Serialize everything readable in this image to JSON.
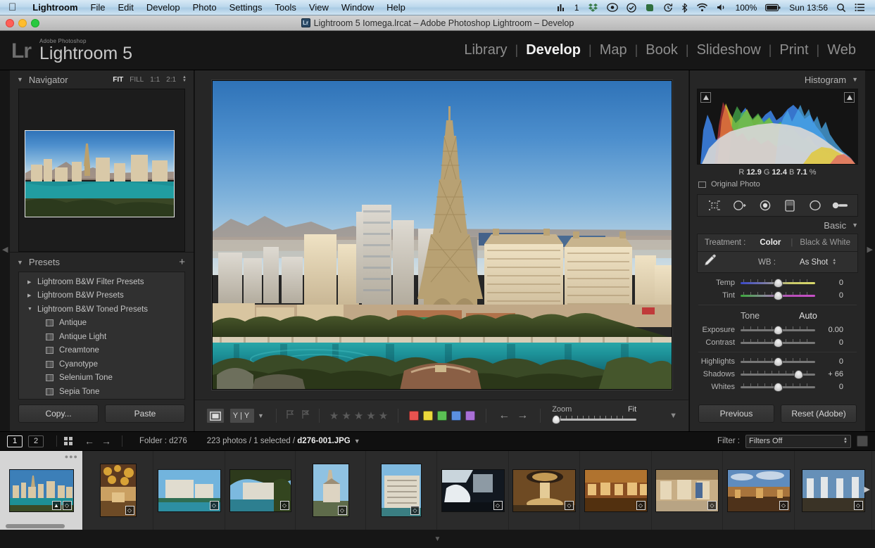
{
  "macmenu": {
    "apple_icon": "apple-logo",
    "items": [
      {
        "label": "Lightroom",
        "bold": true
      },
      {
        "label": "File",
        "bold": false
      },
      {
        "label": "Edit",
        "bold": false
      },
      {
        "label": "Develop",
        "bold": false
      },
      {
        "label": "Photo",
        "bold": false
      },
      {
        "label": "Settings",
        "bold": false
      },
      {
        "label": "Tools",
        "bold": false
      },
      {
        "label": "View",
        "bold": false
      },
      {
        "label": "Window",
        "bold": false
      },
      {
        "label": "Help",
        "bold": false
      }
    ],
    "status": {
      "istat_count": "1",
      "battery_percent": "100%",
      "clock": "Sun 13:56"
    }
  },
  "titlebar": {
    "title": "Lightroom 5 Iomega.lrcat – Adobe Photoshop Lightroom – Develop",
    "doc_icon_label": "Lr"
  },
  "header": {
    "logo_mark": "Lr",
    "logo_superscript": "Adobe Photoshop",
    "logo_name": "Lightroom 5",
    "modules": [
      {
        "label": "Library",
        "active": false
      },
      {
        "label": "Develop",
        "active": true
      },
      {
        "label": "Map",
        "active": false
      },
      {
        "label": "Book",
        "active": false
      },
      {
        "label": "Slideshow",
        "active": false
      },
      {
        "label": "Print",
        "active": false
      },
      {
        "label": "Web",
        "active": false
      }
    ]
  },
  "left_panel": {
    "navigator": {
      "title": "Navigator",
      "zoom_options": [
        {
          "label": "FIT",
          "active": true
        },
        {
          "label": "FILL",
          "active": false
        },
        {
          "label": "1:1",
          "active": false
        },
        {
          "label": "2:1",
          "active": false
        }
      ]
    },
    "presets": {
      "title": "Presets",
      "add_label": "+",
      "items": [
        {
          "label": "Lightroom B&W Filter Presets",
          "type": "group",
          "expanded": false
        },
        {
          "label": "Lightroom B&W Presets",
          "type": "group",
          "expanded": false
        },
        {
          "label": "Lightroom B&W Toned Presets",
          "type": "group",
          "expanded": true
        },
        {
          "label": "Antique",
          "type": "preset"
        },
        {
          "label": "Antique Light",
          "type": "preset"
        },
        {
          "label": "Creamtone",
          "type": "preset"
        },
        {
          "label": "Cyanotype",
          "type": "preset"
        },
        {
          "label": "Selenium Tone",
          "type": "preset"
        },
        {
          "label": "Sepia Tone",
          "type": "preset"
        }
      ]
    },
    "buttons": {
      "copy": "Copy...",
      "paste": "Paste"
    }
  },
  "right_panel": {
    "histogram": {
      "title": "Histogram",
      "readout": {
        "r_label": "R",
        "r_value": "12.9",
        "g_label": "G",
        "g_value": "12.4",
        "b_label": "B",
        "b_value": "7.1",
        "unit": "%"
      },
      "original_photo_label": "Original Photo"
    },
    "tools": [
      {
        "name": "crop-overlay-icon"
      },
      {
        "name": "spot-removal-icon"
      },
      {
        "name": "red-eye-correction-icon"
      },
      {
        "name": "graduated-filter-icon"
      },
      {
        "name": "radial-filter-icon"
      },
      {
        "name": "adjustment-brush-icon"
      }
    ],
    "basic": {
      "title": "Basic",
      "treatment_label": "Treatment :",
      "treatment_options": [
        {
          "label": "Color",
          "active": true
        },
        {
          "label": "Black & White",
          "active": false
        }
      ],
      "wb_label": "WB :",
      "wb_value": "As Shot",
      "wb_sliders": [
        {
          "name": "Temp",
          "value": "0",
          "pos": 50,
          "track": "temp"
        },
        {
          "name": "Tint",
          "value": "0",
          "pos": 50,
          "track": "tint"
        }
      ],
      "tone_label": "Tone",
      "auto_label": "Auto",
      "tone_sliders": [
        {
          "name": "Exposure",
          "value": "0.00",
          "pos": 50,
          "track": "plain"
        },
        {
          "name": "Contrast",
          "value": "0",
          "pos": 50,
          "track": "plain"
        }
      ],
      "tone_sliders2": [
        {
          "name": "Highlights",
          "value": "0",
          "pos": 50,
          "track": "plain"
        },
        {
          "name": "Shadows",
          "value": "+ 66",
          "pos": 78,
          "track": "plain"
        },
        {
          "name": "Whites",
          "value": "0",
          "pos": 50,
          "track": "plain"
        }
      ]
    },
    "buttons": {
      "previous": "Previous",
      "reset": "Reset (Adobe)"
    }
  },
  "toolbar": {
    "view_icon": "loupe-view-icon",
    "compare_label": "Y|Y",
    "stars": 5,
    "color_labels": [
      "#e8534f",
      "#ecd93b",
      "#5bc054",
      "#5b8fe0",
      "#a96fd6"
    ],
    "zoom_label": "Zoom",
    "zoom_value": "Fit"
  },
  "filmstrip_bar": {
    "page_buttons": [
      {
        "label": "1",
        "selected": true
      },
      {
        "label": "2",
        "selected": false
      }
    ],
    "folder_label": "Folder : d276",
    "stats_prefix": "223 photos / 1 selected / ",
    "stats_file": "d276-001.JPG",
    "filter_label": "Filter :",
    "filter_value": "Filters Off"
  },
  "filmstrip": {
    "thumbnails": [
      {
        "name": "las-vegas-strip-skyline",
        "orientation": "landscape",
        "selected": true,
        "badges": 2,
        "scene": "skyline"
      },
      {
        "name": "ceiling-glass-flowers",
        "orientation": "portrait",
        "selected": false,
        "badges": 1,
        "scene": "interior-warm"
      },
      {
        "name": "bellagio-hotel-lake",
        "orientation": "landscape",
        "selected": false,
        "badges": 1,
        "scene": "hotel-lake"
      },
      {
        "name": "bellagio-through-trees",
        "orientation": "landscape",
        "selected": false,
        "badges": 1,
        "scene": "hotel-trees"
      },
      {
        "name": "chapel-tower",
        "orientation": "portrait",
        "selected": false,
        "badges": 1,
        "scene": "chapel"
      },
      {
        "name": "hotel-facade-daylight",
        "orientation": "portrait",
        "selected": false,
        "badges": 1,
        "scene": "hotel-facade"
      },
      {
        "name": "fountain-night-shot",
        "orientation": "landscape",
        "selected": false,
        "badges": 1,
        "scene": "night-building"
      },
      {
        "name": "caesars-palace-interior",
        "orientation": "landscape",
        "selected": false,
        "badges": 1,
        "scene": "dome-interior"
      },
      {
        "name": "casino-floor",
        "orientation": "landscape",
        "selected": false,
        "badges": 1,
        "scene": "casino"
      },
      {
        "name": "shopping-mall-corridor",
        "orientation": "landscape",
        "selected": false,
        "badges": 1,
        "scene": "mall"
      },
      {
        "name": "forum-shops-sky-ceiling",
        "orientation": "landscape",
        "selected": false,
        "badges": 1,
        "scene": "sky-ceiling"
      },
      {
        "name": "forum-shops-colonnade",
        "orientation": "landscape",
        "selected": false,
        "badges": 1,
        "scene": "colonnade"
      }
    ]
  },
  "main_photo": {
    "name": "las-vegas-bellagio-fountain-view",
    "description": "Las Vegas strip skyline with Eiffel Tower replica over Bellagio lake"
  }
}
